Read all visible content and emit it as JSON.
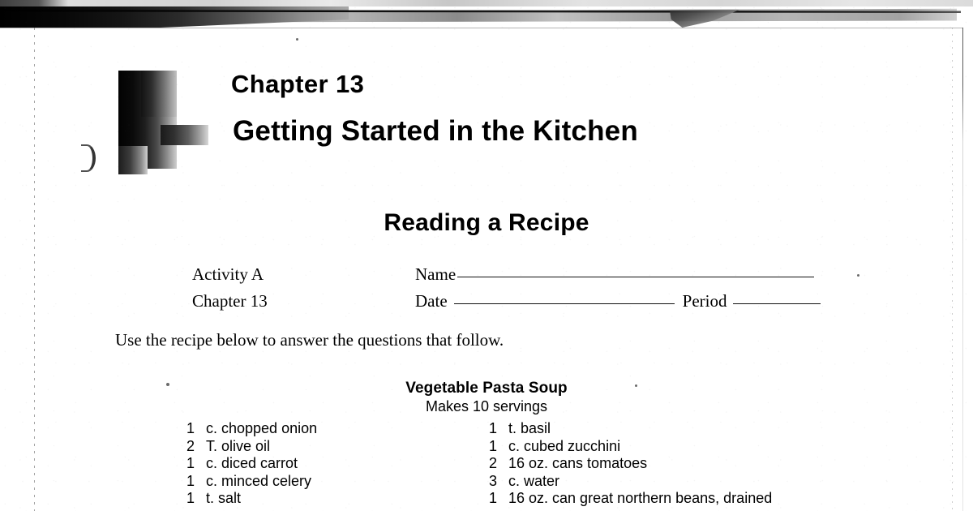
{
  "document": {
    "chapter_label": "Chapter 13",
    "chapter_title": "Getting Started in the Kitchen",
    "section_title": "Reading a Recipe"
  },
  "form": {
    "activity_label": "Activity A",
    "chapter_label": "Chapter 13",
    "name_label": "Name",
    "date_label": "Date",
    "period_label": "Period",
    "name_value": "",
    "date_value": "",
    "period_value": ""
  },
  "instructions": {
    "text": "Use the recipe below to answer the questions that follow."
  },
  "recipe": {
    "name": "Vegetable Pasta Soup",
    "servings": "Makes 10 servings",
    "ingredients_left": [
      {
        "qty": "1",
        "text": "c. chopped onion"
      },
      {
        "qty": "2",
        "text": "T. olive oil"
      },
      {
        "qty": "1",
        "text": "c. diced carrot"
      },
      {
        "qty": "1",
        "text": "c. minced celery"
      },
      {
        "qty": "1",
        "text": "t. salt"
      }
    ],
    "ingredients_right": [
      {
        "qty": "1",
        "text": "t. basil"
      },
      {
        "qty": "1",
        "text": "c. cubed zucchini"
      },
      {
        "qty": "2",
        "text": "16 oz. cans tomatoes"
      },
      {
        "qty": "3",
        "text": "c. water"
      },
      {
        "qty": "1",
        "text": "16 oz. can great northern beans, drained"
      }
    ]
  },
  "scan_artifacts": {
    "top_band": "dark-scan-band",
    "fold_mark": "paper-fold-shadow",
    "left_edge": "dotted-scan-edge",
    "right_edge": "page-edge-line",
    "margin_mark": "crescent-smudge"
  },
  "colors": {
    "page_background": "#ffffff",
    "ink": "#000000",
    "scan_shadow": "#1d1d1d",
    "scan_gray": "#c9c9c9"
  }
}
